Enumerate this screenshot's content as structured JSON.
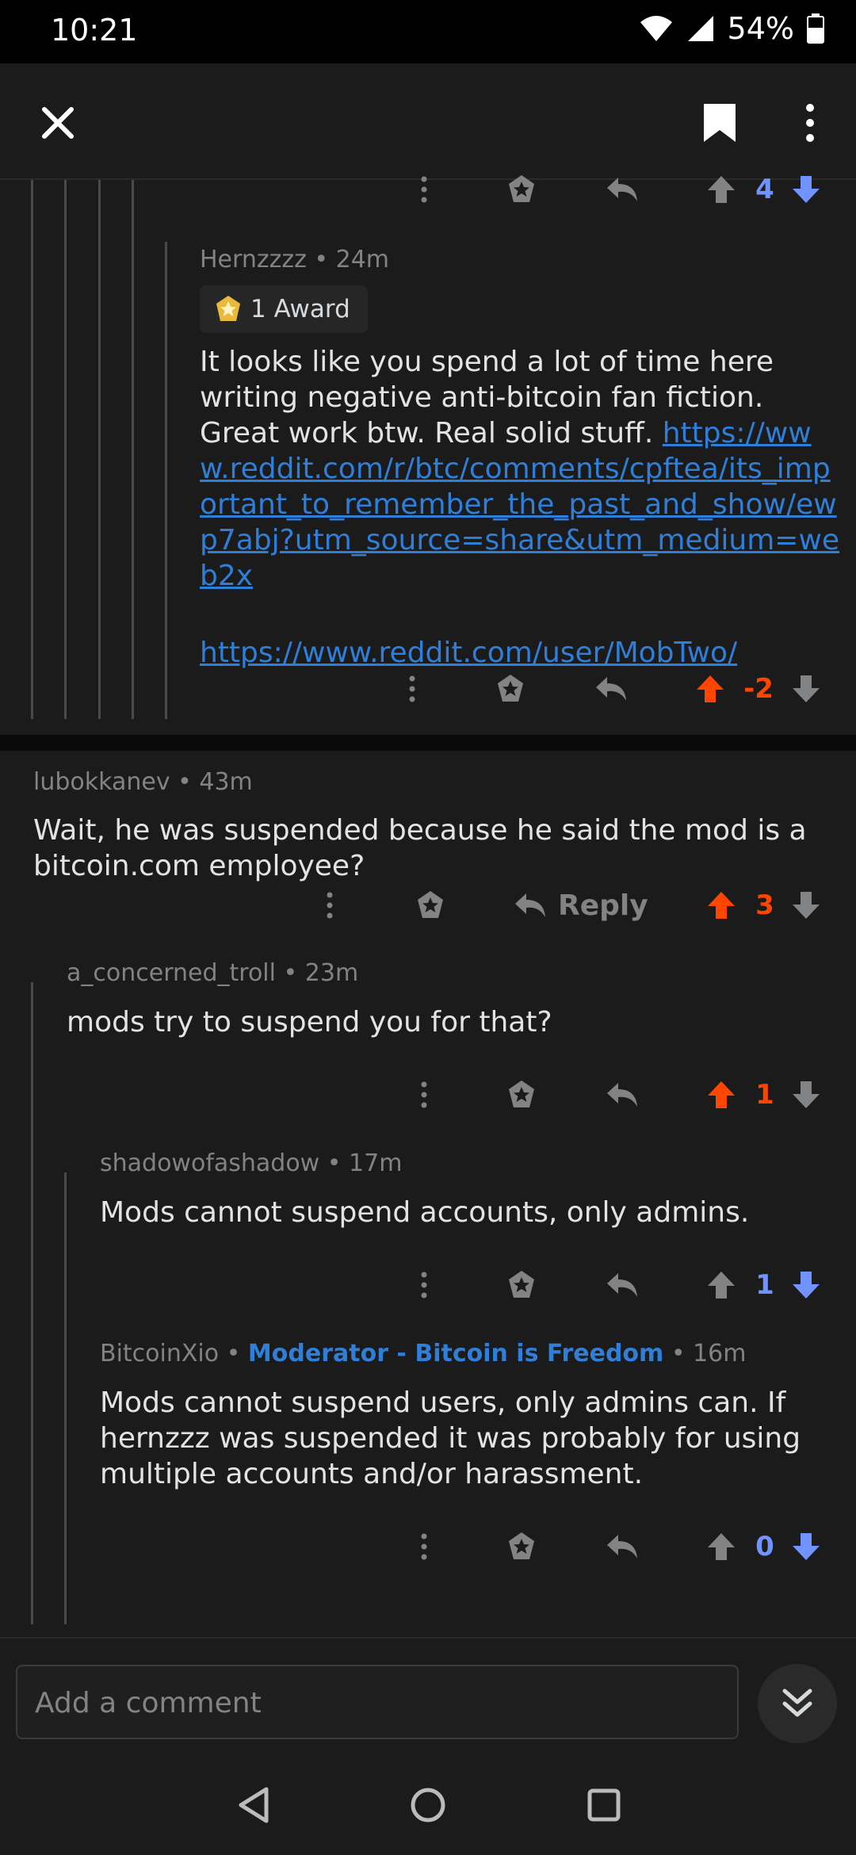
{
  "status_bar": {
    "time": "10:21",
    "battery": "54%"
  },
  "toolbar": {
    "close_icon": "close-icon",
    "bookmark_icon": "bookmark-icon",
    "more_icon": "more-vertical-icon"
  },
  "comments": [
    {
      "id": "c0",
      "score": "4",
      "vote": "down"
    },
    {
      "id": "c1",
      "author": "Hernzzzz",
      "time": "24m",
      "award": "1 Award",
      "body_text": "It looks like you spend a lot of time here writing negative anti-bitcoin fan fiction.  Great work btw. Real solid stuff. ",
      "link1": "https://www.reddit.com/r/btc/comments/cpftea/its_important_to_remember_the_past_and_show/ewp7abj?utm_source=share&utm_medium=web2x",
      "link2": "https://www.reddit.com/user/MobTwo/",
      "score": "-2",
      "vote": "up"
    },
    {
      "id": "c2",
      "author": "lubokkanev",
      "time": "43m",
      "body": "Wait, he was suspended because he said the mod is a bitcoin.com employee?",
      "reply_label": "Reply",
      "score": "3",
      "vote": "up"
    },
    {
      "id": "c3",
      "author": "a_concerned_troll",
      "time": "23m",
      "body": "mods try to suspend you for that?",
      "score": "1",
      "vote": "up"
    },
    {
      "id": "c4",
      "author": "shadowofashadow",
      "time": "17m",
      "body": "Mods cannot suspend accounts, only admins.",
      "score": "1",
      "vote": "down"
    },
    {
      "id": "c5",
      "author": "BitcoinXio",
      "flair": "Moderator - Bitcoin is Freedom",
      "time": "16m",
      "body": "Mods cannot suspend users, only admins can. If hernzzz was suspended it was probably for using multiple accounts and/or harassment.",
      "score": "0",
      "vote": "down"
    }
  ],
  "separator": "•",
  "composer": {
    "placeholder": "Add a comment"
  },
  "colors": {
    "upvote": "#ff4500",
    "downvote": "#7193ff",
    "link": "#2f7ed8",
    "background": "#1b1b1b"
  }
}
